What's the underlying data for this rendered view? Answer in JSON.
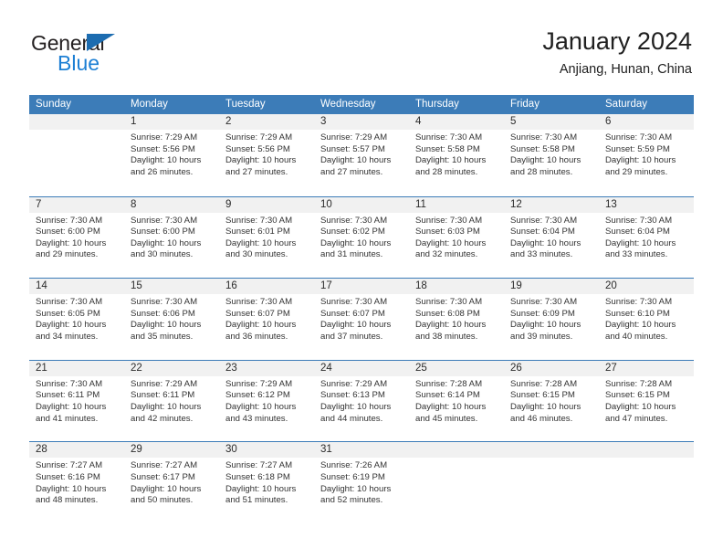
{
  "brand": {
    "name_top": "General",
    "name_bottom": "Blue",
    "triangle_color": "#1c6cb0",
    "blue_color": "#1c7fd4"
  },
  "header": {
    "title": "January 2024",
    "subtitle": "Anjiang, Hunan, China"
  },
  "theme": {
    "header_blue": "#3c7cb8",
    "daynum_bg": "#f1f1f1",
    "text": "#333333"
  },
  "weekdays": [
    "Sunday",
    "Monday",
    "Tuesday",
    "Wednesday",
    "Thursday",
    "Friday",
    "Saturday"
  ],
  "labels": {
    "sunrise_prefix": "Sunrise:",
    "sunset_prefix": "Sunset:",
    "daylight_prefix": "Daylight:"
  },
  "weeks": [
    [
      {
        "day": "",
        "empty": true
      },
      {
        "day": "1",
        "sunrise": "Sunrise: 7:29 AM",
        "sunset": "Sunset: 5:56 PM",
        "daylight1": "Daylight: 10 hours",
        "daylight2": "and 26 minutes."
      },
      {
        "day": "2",
        "sunrise": "Sunrise: 7:29 AM",
        "sunset": "Sunset: 5:56 PM",
        "daylight1": "Daylight: 10 hours",
        "daylight2": "and 27 minutes."
      },
      {
        "day": "3",
        "sunrise": "Sunrise: 7:29 AM",
        "sunset": "Sunset: 5:57 PM",
        "daylight1": "Daylight: 10 hours",
        "daylight2": "and 27 minutes."
      },
      {
        "day": "4",
        "sunrise": "Sunrise: 7:30 AM",
        "sunset": "Sunset: 5:58 PM",
        "daylight1": "Daylight: 10 hours",
        "daylight2": "and 28 minutes."
      },
      {
        "day": "5",
        "sunrise": "Sunrise: 7:30 AM",
        "sunset": "Sunset: 5:58 PM",
        "daylight1": "Daylight: 10 hours",
        "daylight2": "and 28 minutes."
      },
      {
        "day": "6",
        "sunrise": "Sunrise: 7:30 AM",
        "sunset": "Sunset: 5:59 PM",
        "daylight1": "Daylight: 10 hours",
        "daylight2": "and 29 minutes."
      }
    ],
    [
      {
        "day": "7",
        "sunrise": "Sunrise: 7:30 AM",
        "sunset": "Sunset: 6:00 PM",
        "daylight1": "Daylight: 10 hours",
        "daylight2": "and 29 minutes."
      },
      {
        "day": "8",
        "sunrise": "Sunrise: 7:30 AM",
        "sunset": "Sunset: 6:00 PM",
        "daylight1": "Daylight: 10 hours",
        "daylight2": "and 30 minutes."
      },
      {
        "day": "9",
        "sunrise": "Sunrise: 7:30 AM",
        "sunset": "Sunset: 6:01 PM",
        "daylight1": "Daylight: 10 hours",
        "daylight2": "and 30 minutes."
      },
      {
        "day": "10",
        "sunrise": "Sunrise: 7:30 AM",
        "sunset": "Sunset: 6:02 PM",
        "daylight1": "Daylight: 10 hours",
        "daylight2": "and 31 minutes."
      },
      {
        "day": "11",
        "sunrise": "Sunrise: 7:30 AM",
        "sunset": "Sunset: 6:03 PM",
        "daylight1": "Daylight: 10 hours",
        "daylight2": "and 32 minutes."
      },
      {
        "day": "12",
        "sunrise": "Sunrise: 7:30 AM",
        "sunset": "Sunset: 6:04 PM",
        "daylight1": "Daylight: 10 hours",
        "daylight2": "and 33 minutes."
      },
      {
        "day": "13",
        "sunrise": "Sunrise: 7:30 AM",
        "sunset": "Sunset: 6:04 PM",
        "daylight1": "Daylight: 10 hours",
        "daylight2": "and 33 minutes."
      }
    ],
    [
      {
        "day": "14",
        "sunrise": "Sunrise: 7:30 AM",
        "sunset": "Sunset: 6:05 PM",
        "daylight1": "Daylight: 10 hours",
        "daylight2": "and 34 minutes."
      },
      {
        "day": "15",
        "sunrise": "Sunrise: 7:30 AM",
        "sunset": "Sunset: 6:06 PM",
        "daylight1": "Daylight: 10 hours",
        "daylight2": "and 35 minutes."
      },
      {
        "day": "16",
        "sunrise": "Sunrise: 7:30 AM",
        "sunset": "Sunset: 6:07 PM",
        "daylight1": "Daylight: 10 hours",
        "daylight2": "and 36 minutes."
      },
      {
        "day": "17",
        "sunrise": "Sunrise: 7:30 AM",
        "sunset": "Sunset: 6:07 PM",
        "daylight1": "Daylight: 10 hours",
        "daylight2": "and 37 minutes."
      },
      {
        "day": "18",
        "sunrise": "Sunrise: 7:30 AM",
        "sunset": "Sunset: 6:08 PM",
        "daylight1": "Daylight: 10 hours",
        "daylight2": "and 38 minutes."
      },
      {
        "day": "19",
        "sunrise": "Sunrise: 7:30 AM",
        "sunset": "Sunset: 6:09 PM",
        "daylight1": "Daylight: 10 hours",
        "daylight2": "and 39 minutes."
      },
      {
        "day": "20",
        "sunrise": "Sunrise: 7:30 AM",
        "sunset": "Sunset: 6:10 PM",
        "daylight1": "Daylight: 10 hours",
        "daylight2": "and 40 minutes."
      }
    ],
    [
      {
        "day": "21",
        "sunrise": "Sunrise: 7:30 AM",
        "sunset": "Sunset: 6:11 PM",
        "daylight1": "Daylight: 10 hours",
        "daylight2": "and 41 minutes."
      },
      {
        "day": "22",
        "sunrise": "Sunrise: 7:29 AM",
        "sunset": "Sunset: 6:11 PM",
        "daylight1": "Daylight: 10 hours",
        "daylight2": "and 42 minutes."
      },
      {
        "day": "23",
        "sunrise": "Sunrise: 7:29 AM",
        "sunset": "Sunset: 6:12 PM",
        "daylight1": "Daylight: 10 hours",
        "daylight2": "and 43 minutes."
      },
      {
        "day": "24",
        "sunrise": "Sunrise: 7:29 AM",
        "sunset": "Sunset: 6:13 PM",
        "daylight1": "Daylight: 10 hours",
        "daylight2": "and 44 minutes."
      },
      {
        "day": "25",
        "sunrise": "Sunrise: 7:28 AM",
        "sunset": "Sunset: 6:14 PM",
        "daylight1": "Daylight: 10 hours",
        "daylight2": "and 45 minutes."
      },
      {
        "day": "26",
        "sunrise": "Sunrise: 7:28 AM",
        "sunset": "Sunset: 6:15 PM",
        "daylight1": "Daylight: 10 hours",
        "daylight2": "and 46 minutes."
      },
      {
        "day": "27",
        "sunrise": "Sunrise: 7:28 AM",
        "sunset": "Sunset: 6:15 PM",
        "daylight1": "Daylight: 10 hours",
        "daylight2": "and 47 minutes."
      }
    ],
    [
      {
        "day": "28",
        "sunrise": "Sunrise: 7:27 AM",
        "sunset": "Sunset: 6:16 PM",
        "daylight1": "Daylight: 10 hours",
        "daylight2": "and 48 minutes."
      },
      {
        "day": "29",
        "sunrise": "Sunrise: 7:27 AM",
        "sunset": "Sunset: 6:17 PM",
        "daylight1": "Daylight: 10 hours",
        "daylight2": "and 50 minutes."
      },
      {
        "day": "30",
        "sunrise": "Sunrise: 7:27 AM",
        "sunset": "Sunset: 6:18 PM",
        "daylight1": "Daylight: 10 hours",
        "daylight2": "and 51 minutes."
      },
      {
        "day": "31",
        "sunrise": "Sunrise: 7:26 AM",
        "sunset": "Sunset: 6:19 PM",
        "daylight1": "Daylight: 10 hours",
        "daylight2": "and 52 minutes."
      },
      {
        "day": "",
        "empty": true
      },
      {
        "day": "",
        "empty": true
      },
      {
        "day": "",
        "empty": true
      }
    ]
  ]
}
